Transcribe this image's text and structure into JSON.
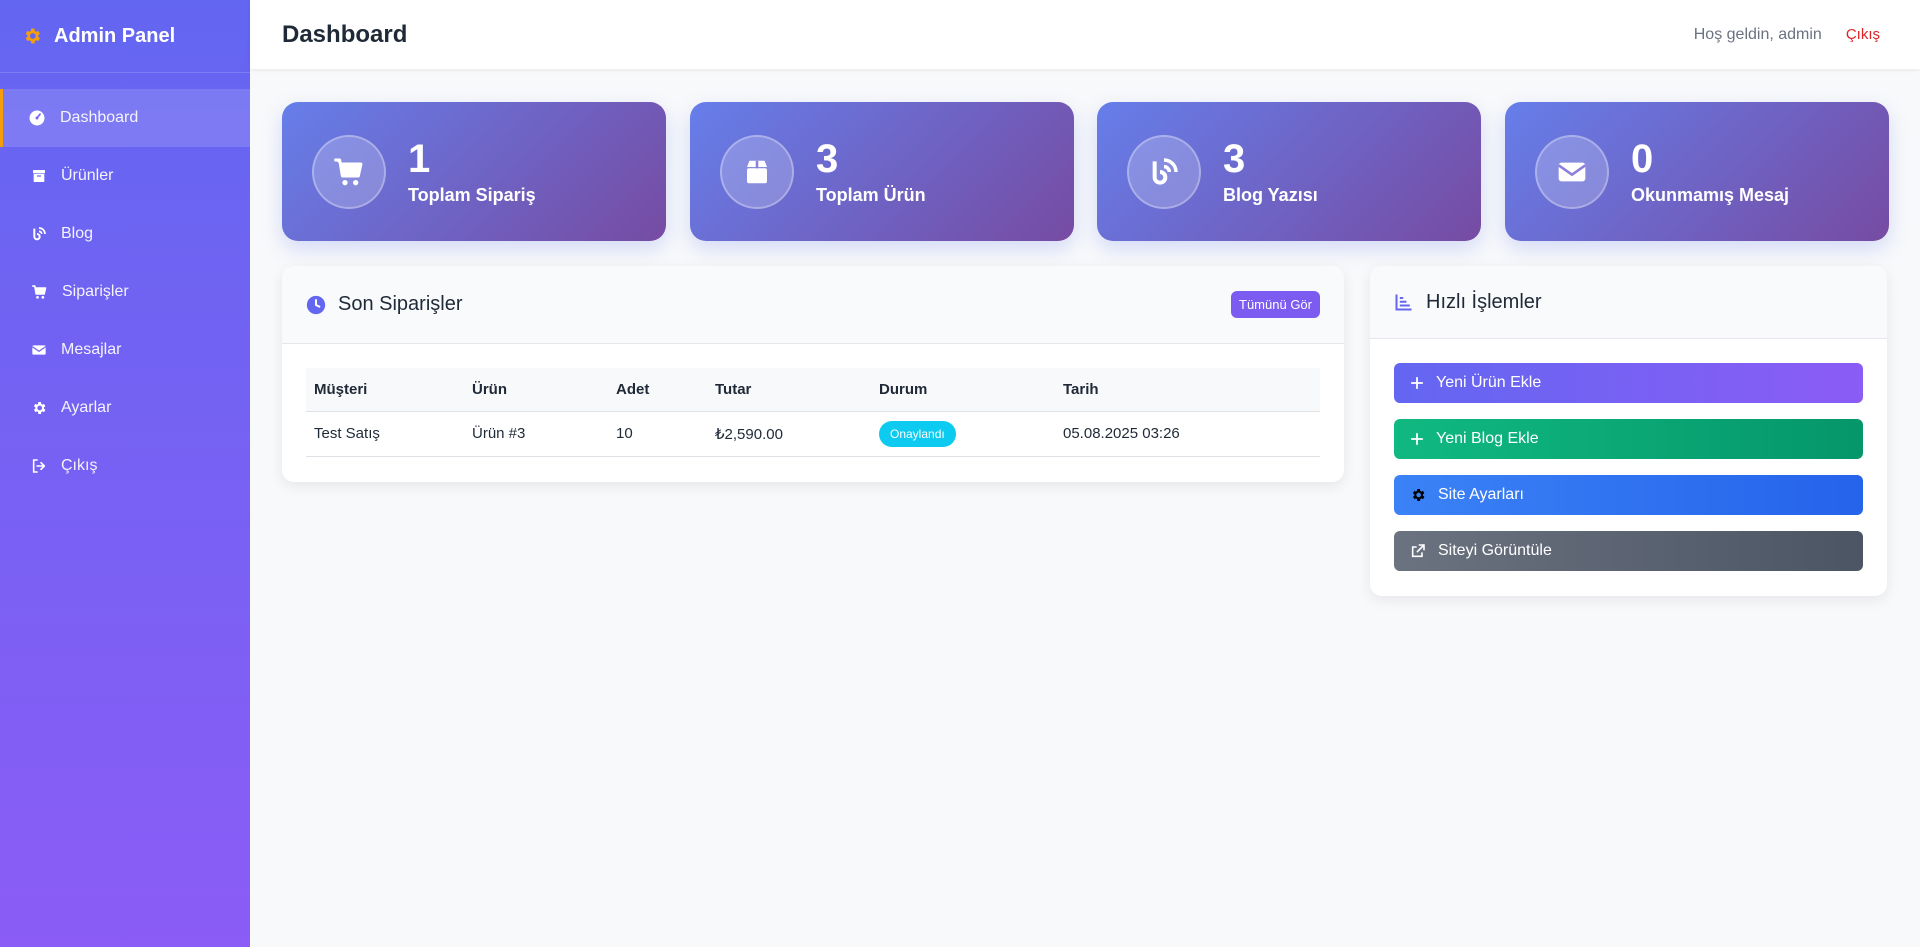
{
  "brand": {
    "title": "Admin Panel",
    "icon": "gear-icon",
    "icon_color": "#f59e0b"
  },
  "sidebar": {
    "items": [
      {
        "label": "Dashboard",
        "icon": "dashboard-icon",
        "active": true
      },
      {
        "label": "Ürünler",
        "icon": "box-icon"
      },
      {
        "label": "Blog",
        "icon": "blog-icon"
      },
      {
        "label": "Siparişler",
        "icon": "cart-icon"
      },
      {
        "label": "Mesajlar",
        "icon": "envelope-icon"
      },
      {
        "label": "Ayarlar",
        "icon": "gear-icon"
      },
      {
        "label": "Çıkış",
        "icon": "sign-out-icon"
      }
    ]
  },
  "header": {
    "title": "Dashboard",
    "welcome": "Hoş geldin, admin",
    "logout": "Çıkış"
  },
  "stats": [
    {
      "value": "1",
      "label": "Toplam Sipariş",
      "icon": "cart-icon"
    },
    {
      "value": "3",
      "label": "Toplam Ürün",
      "icon": "box-icon"
    },
    {
      "value": "3",
      "label": "Blog Yazısı",
      "icon": "blog-icon"
    },
    {
      "value": "0",
      "label": "Okunmamış Mesaj",
      "icon": "envelope-icon"
    }
  ],
  "orders": {
    "title": "Son Siparişler",
    "view_all": "Tümünü Gör",
    "columns": [
      "Müşteri",
      "Ürün",
      "Adet",
      "Tutar",
      "Durum",
      "Tarih"
    ],
    "rows": [
      {
        "customer": "Test Satış",
        "product": "Ürün #3",
        "qty": "10",
        "amount": "₺2,590.00",
        "status": "Onaylandı",
        "date": "05.08.2025 03:26"
      }
    ]
  },
  "quick_actions": {
    "title": "Hızlı İşlemler",
    "items": [
      {
        "label": "Yeni Ürün Ekle",
        "icon": "plus-icon"
      },
      {
        "label": "Yeni Blog Ekle",
        "icon": "plus-icon"
      },
      {
        "label": "Site Ayarları",
        "icon": "gear-icon"
      },
      {
        "label": "Siteyi Görüntüle",
        "icon": "external-link-icon"
      }
    ]
  },
  "colors": {
    "sidebar_start": "#6366f1",
    "sidebar_end": "#8b5cf6",
    "stat_start": "#667eea",
    "stat_end": "#764ba2",
    "active_border": "#f59e0b",
    "logout": "#dc2626",
    "badge": "#0dcaf0"
  }
}
